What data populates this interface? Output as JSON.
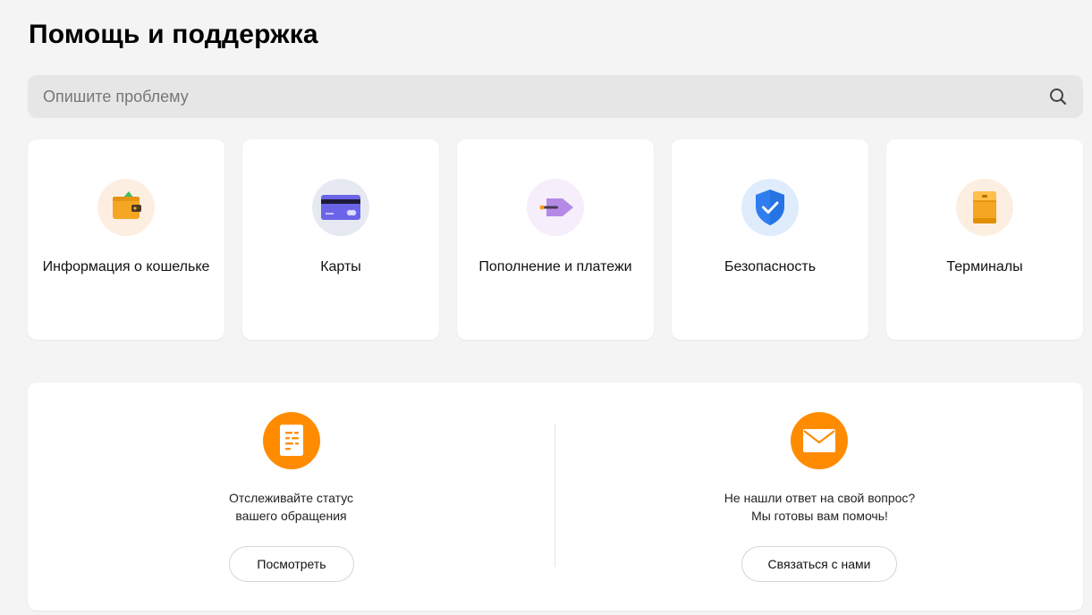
{
  "header": {
    "title": "Помощь и поддержка"
  },
  "search": {
    "placeholder": "Опишите проблему",
    "value": ""
  },
  "categories": [
    {
      "label": "Информация о кошельке",
      "icon": "wallet-icon",
      "bg": "#fdeee2"
    },
    {
      "label": "Карты",
      "icon": "credit-card-icon",
      "bg": "#e6e9f2"
    },
    {
      "label": "Пополнение и платежи",
      "icon": "payment-tag-icon",
      "bg": "#f6eefb"
    },
    {
      "label": "Безопасность",
      "icon": "shield-check-icon",
      "bg": "#dfecfb"
    },
    {
      "label": "Терминалы",
      "icon": "terminal-box-icon",
      "bg": "#fdeee2"
    }
  ],
  "support": {
    "status": {
      "line1": "Отслеживайте статус",
      "line2": "вашего обращения",
      "button": "Посмотреть",
      "icon": "document-icon"
    },
    "contact": {
      "line1": "Не нашли ответ на свой вопрос?",
      "line2": "Мы готовы вам помочь!",
      "button": "Связаться с нами",
      "icon": "envelope-icon"
    }
  },
  "colors": {
    "accent": "#ff8c00",
    "background": "#f4f4f4",
    "search_bg": "#e6e6e6"
  }
}
